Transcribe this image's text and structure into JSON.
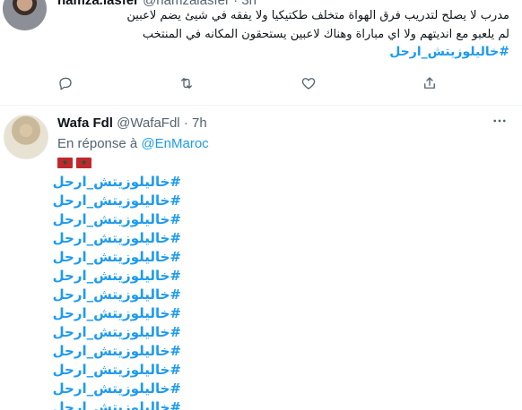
{
  "tweet1": {
    "name": "hamza.lasfer",
    "handle": "@hamzalasfer",
    "separator": " · ",
    "time": "3h",
    "text_line1": "مدرب لا يصلح لتدريب فرق الهواة متخلف طكتيكيا ولا يفقه في شيئ يضم لاعبين",
    "text_line2": "لم يلعبو مع انديتهم ولا اي مباراة وهناك لاعبين يستحقون المكانه في المنتخب",
    "hashtag": "#خاليلوزيتش_ارحل",
    "actions": [
      "reply-icon",
      "retweet-icon",
      "like-icon",
      "share-icon"
    ]
  },
  "tweet2": {
    "name": "Wafa Fdl",
    "handle": "@WafaFdl",
    "separator": " · ",
    "time": "7h",
    "reply_prefix": "En réponse à ",
    "reply_mention": "@EnMaroc",
    "flags": [
      "flag-morocco-icon",
      "flag-morocco-icon"
    ],
    "hashtags": [
      "#خاليلوزيتش_ارحل",
      "#خاليلوزيتش_ارحل",
      "#خاليلوزيتش_ارحل",
      "#خاليلوزيتش_ارحل",
      "#خاليلوزيتش_ارحل",
      "#خاليلوزيتش_ارحل",
      "#خاليلوزيتش_ارحل",
      "#خاليلوزيتش_ارحل",
      "#خاليلوزيتش_ارحل",
      "#خاليلوزيتش_ارحل",
      "#خاليلوزيتش_ارحل",
      "#خاليلوزيتش_ارحل",
      "#خاليلوزيتش_ارحل"
    ]
  },
  "colors": {
    "link": "#1d9bf0",
    "secondary_text": "#536471",
    "primary_text": "#0f1419",
    "flag_red": "#c1272d",
    "flag_star": "#006233"
  }
}
